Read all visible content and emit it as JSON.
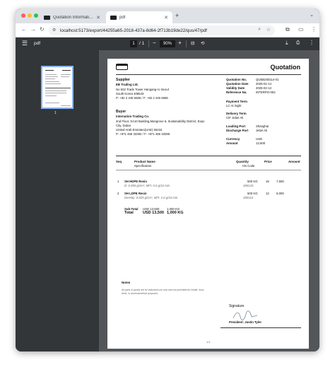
{
  "browser": {
    "tabs": [
      {
        "label": "Quotation Information | Eastr"
      },
      {
        "label": "pdf"
      }
    ],
    "new_tab_glyph": "+",
    "url": "localhost:5173/export/44255a65-2018-437a-8d64-2f713b19de22/qus/47/pdf",
    "colors": {
      "tabbar": "#dee1e6",
      "close": "#ff5f57",
      "minimize": "#febc2e",
      "maximize": "#28c840"
    }
  },
  "pdf_toolbar": {
    "menu_icon": "hamburger-menu-icon",
    "title": "pdf",
    "page_current": "1",
    "page_total": "/ 1",
    "zoom": "90%",
    "zoom_out": "−",
    "zoom_in": "+",
    "download_icon": "download-icon",
    "print_icon": "print-icon",
    "more_icon": "more-vert-icon"
  },
  "sidebar": {
    "thumbnail_number": "1"
  },
  "document": {
    "title": "Quotation",
    "supplier_heading": "Supplier",
    "supplier_lines": [
      "EB Trading Ltd.",
      "No 502 Trade Tower Hangang-ro Seoul",
      "South Korea 408543",
      "P: +82 2 445 6565 / F: +82 2 445 6566"
    ],
    "buyer_heading": "Buyer",
    "buyer_lines": [
      "Internation Trading Co.",
      "2nd Floor, SA10 Building,Mangrove 6, Sustainability District, Expo",
      "City, Dubai",
      "United Arab Emirates(UAE) 55434",
      "P: +971 455 33392 / F: +971 455 33395"
    ],
    "meta": [
      {
        "label": "Quotation No.",
        "value": "QUEB250114-01"
      },
      {
        "label": "Quotation Date",
        "value": "2025-01-14"
      },
      {
        "label": "Validity Date",
        "value": "2025-02-13"
      },
      {
        "label": "Reference No.",
        "value": "INTERPO-002"
      }
    ],
    "payment_term_label": "Payment Term",
    "payment_term_value": "LC At Sight",
    "delivery_term_label": "Delivery Term",
    "delivery_term_value": "CIF Jebel Ali",
    "ports": [
      {
        "label": "Loading Port",
        "value": "Shanghai"
      },
      {
        "label": "Discharge Port",
        "value": "Jebel Ali"
      }
    ],
    "currency_label": "Currency",
    "currency_value": "USD",
    "amount_label": "Amount",
    "amount_value": "13,500",
    "table_headers": {
      "seq": "Seq",
      "product": "Product Name",
      "spec": "Specification",
      "quantity": "Quantity",
      "hs": "HS Code",
      "price": "Price",
      "amount": "Amount"
    },
    "rows": [
      {
        "seq": "1",
        "name": "SH HDPE Resin",
        "spec": "D: 0.950 g/cm³, MFI: 0.5 g/10 min",
        "quantity": "500 KG",
        "hs": "390120",
        "price": "15",
        "amount": "7,500"
      },
      {
        "seq": "2",
        "name": "SH LDPE Resin",
        "spec": "Density: 0.925 g/cm³, MFI: 2.0 g/10 min",
        "quantity": "500 KG",
        "hs": "390110",
        "price": "12",
        "amount": "6,000"
      }
    ],
    "subtotal_label": "Sub-Total",
    "subtotal_amount": "USD 13,500",
    "subtotal_qty": "1,000 KG",
    "total_label": "Total",
    "total_amount": "USD 13,500",
    "total_qty": "1,000 KG",
    "notes_heading": "Notes",
    "notes_text": "All parts of goods are for industrial use only and not permitted for health, food, drink, or pharmaceutical purposes.",
    "signature_label": "Signature",
    "signer": "President: Justin Tyler",
    "page_footer": "1/1"
  }
}
